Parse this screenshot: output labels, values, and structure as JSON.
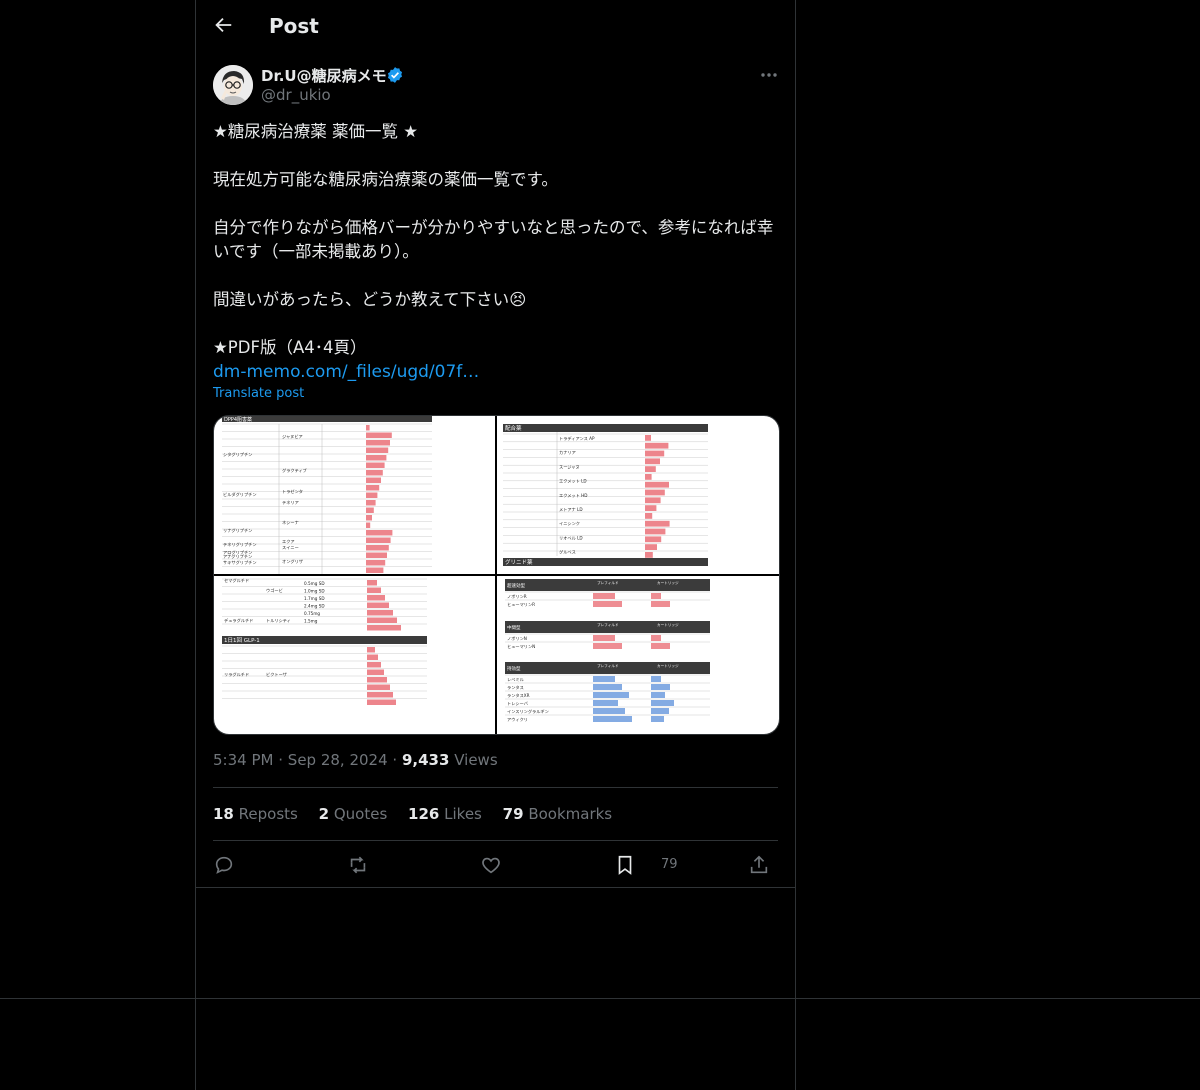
{
  "header": {
    "title": "Post"
  },
  "author": {
    "name": "Dr.U@糖尿病メモ",
    "handle": "@dr_ukio"
  },
  "tweet": {
    "line1": "★糖尿病治療薬 薬価一覧 ★",
    "line2": "現在処方可能な糖尿病治療薬の薬価一覧です。",
    "line3": "自分で作りながら価格バーが分かりやすいなと思ったので、参考になれば幸いです（一部未掲載あり）。",
    "line4": "間違いがあったら、どうか教えて下さい😣",
    "line5": "★PDF版（A4･4頁）",
    "link": "dm-memo.com/_files/ugd/07f…",
    "translate": "Translate post"
  },
  "media": {
    "tile1": {
      "section": "DPP4阻害薬",
      "drugs": [
        "シタグリプチン",
        "ビルダグリプチン",
        "リナグリプチン",
        "テネリグリプチン",
        "アログリプチン",
        "アナグリプチン",
        "サキサグリプチン"
      ],
      "brands": [
        "ジャヌビア",
        "グラクティブ",
        "トラゼンタ",
        "テネリア",
        "ネシーナ",
        "エクア",
        "スイニー",
        "オングリザ"
      ]
    },
    "tile2": {
      "section": "配合薬",
      "rows": [
        "トラディアンス AP",
        "カナリア",
        "スージャヌ",
        "エクメット LD",
        "エクメット HD",
        "メトアナ LD",
        "イニシンク",
        "リオベル LD",
        "グルベス"
      ],
      "section2": "グリニド薬"
    },
    "tile3": {
      "section": "GLP-1",
      "rows": [
        "0.5mg SD",
        "1.0mg SD",
        "1.7mg SD",
        "2.4mg SD",
        "0.75mg",
        "1.5mg"
      ],
      "drugs": [
        "セマグルチド",
        "デュラグルチド",
        "リラグルチド"
      ],
      "brands": [
        "ウゴービ",
        "トルリシティ",
        "ビクトーザ"
      ],
      "section2": "1日1回 GLP-1"
    },
    "tile4": {
      "rows": [
        "ノボリンR",
        "ヒューマリンR",
        "ノボリンN",
        "ヒューマリンN",
        "レベミル",
        "ランタス",
        "ランタスXR",
        "トレシーバ",
        "インスリングラルギン",
        "アウィクリ"
      ],
      "headers": [
        "超速効型",
        "中間型",
        "持効型"
      ],
      "cols": [
        "プレフィルド",
        "カートリッジ"
      ]
    }
  },
  "meta": {
    "time": "5:34 PM",
    "dot1": "·",
    "date": "Sep 28, 2024",
    "dot2": "·",
    "views_num": "9,433",
    "views_label": "Views"
  },
  "stats": {
    "reposts_num": "18",
    "reposts_label": "Reposts",
    "quotes_num": "2",
    "quotes_label": "Quotes",
    "likes_num": "126",
    "likes_label": "Likes",
    "bookmarks_num": "79",
    "bookmarks_label": "Bookmarks"
  },
  "actions": {
    "bookmark_count": "79"
  },
  "colors": {
    "accent": "#1d9bf0",
    "text": "#e7e9ea",
    "muted": "#71767b",
    "border": "#2f3336",
    "bar_red": "#e8676f",
    "bar_blue": "#5b8fd9"
  }
}
